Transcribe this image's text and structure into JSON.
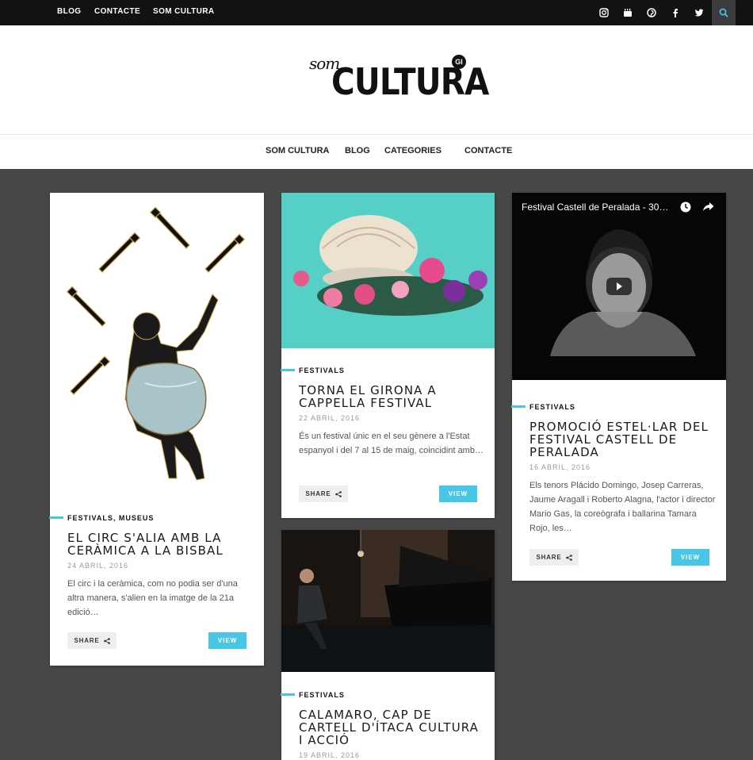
{
  "topbar": {
    "links": [
      "BLOG",
      "CONTACTE",
      "SOM CULTURA"
    ],
    "social_icons": [
      "instagram-icon",
      "youtube-icon",
      "pinterest-icon",
      "facebook-icon",
      "twitter-icon"
    ],
    "search_icon": "search-icon"
  },
  "logo": {
    "som": "som",
    "cultura": "CULTURA",
    "badge": "GI"
  },
  "mainnav": {
    "items": [
      "SOM CULTURA",
      "BLOG",
      "CATEGORIES",
      "CONTACTE"
    ]
  },
  "colors": {
    "accent": "#48c6e6",
    "topbar": "#121212",
    "background": "#474747"
  },
  "posts": [
    {
      "category": "FESTIVALS, MUSEUS",
      "title": "EL CIRC S'ALIA AMB LA CERÀMICA A LA BISBAL",
      "date": "24 ABRIL, 2016",
      "excerpt": "El circ i la ceràmica, com no podia ser d'una altra manera, s'alien en la imatge de la 21a edició…",
      "share": "SHARE",
      "view": "VIEW"
    },
    {
      "category": "FESTIVALS",
      "title": "TORNA EL GIRONA A CAPPELLA FESTIVAL",
      "date": "22 ABRIL, 2016",
      "excerpt": "És un festival únic en el seu gènere a l'Estat espanyol i del 7 al 15 de maig, coincidint amb…",
      "share": "SHARE",
      "view": "VIEW"
    },
    {
      "category": "FESTIVALS",
      "title": "PROMOCIÓ ESTEL·LAR DEL FESTIVAL CASTELL DE PERALADA",
      "date": "16 ABRIL, 2016",
      "excerpt": "Els tenors Plácido Domingo, Josep Carreras, Jaume Aragall i Roberto Alagna, l'actor i director Mario Gas, la coreògrafa i ballarina Tamara Rojo, les…",
      "share": "SHARE",
      "view": "VIEW",
      "video_title": "Festival Castell de Peralada - 30…"
    },
    {
      "category": "FESTIVALS",
      "title": "CALAMARO, CAP DE CARTELL D'ÍTACA CULTURA I ACCIÓ",
      "date": "19 ABRIL, 2016"
    }
  ]
}
